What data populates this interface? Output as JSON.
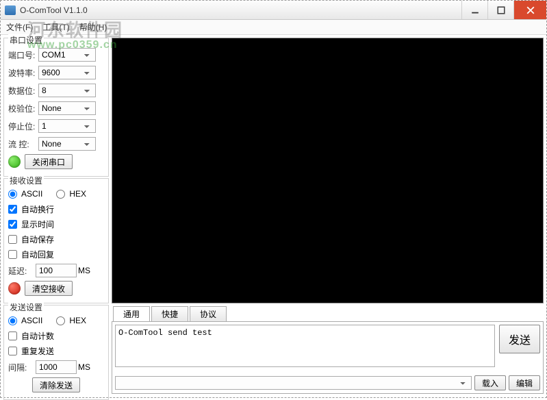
{
  "window": {
    "title": "O-ComTool V1.1.0"
  },
  "menu": {
    "file": "文件(F)",
    "tool": "工具(T)",
    "help": "帮助(H)"
  },
  "watermark": {
    "line1": "河东软件园",
    "line2": "www.pc0359.cn"
  },
  "serial": {
    "title": "串口设置",
    "port_label": "端口号:",
    "port": "COM1",
    "baud_label": "波特率:",
    "baud": "9600",
    "data_label": "数据位:",
    "data": "8",
    "parity_label": "校验位:",
    "parity": "None",
    "stop_label": "停止位:",
    "stop": "1",
    "flow_label": "流  控:",
    "flow": "None",
    "close_btn": "关闭串口"
  },
  "recv": {
    "title": "接收设置",
    "ascii": "ASCII",
    "hex": "HEX",
    "wrap": "自动换行",
    "time": "显示时间",
    "save": "自动保存",
    "reply": "自动回复",
    "delay_label": "延迟:",
    "delay": "100",
    "ms": "MS",
    "clear_btn": "清空接收"
  },
  "send": {
    "title": "发送设置",
    "ascii": "ASCII",
    "hex": "HEX",
    "count": "自动计数",
    "repeat": "重复发送",
    "interval_label": "间隔:",
    "interval": "1000",
    "ms": "MS",
    "clear_btn": "清除发送"
  },
  "tabs": {
    "general": "通用",
    "quick": "快捷",
    "protocol": "协议"
  },
  "sendbox": {
    "text": "O-ComTool send test",
    "send_btn": "发送",
    "load_btn": "载入",
    "edit_btn": "编辑"
  }
}
